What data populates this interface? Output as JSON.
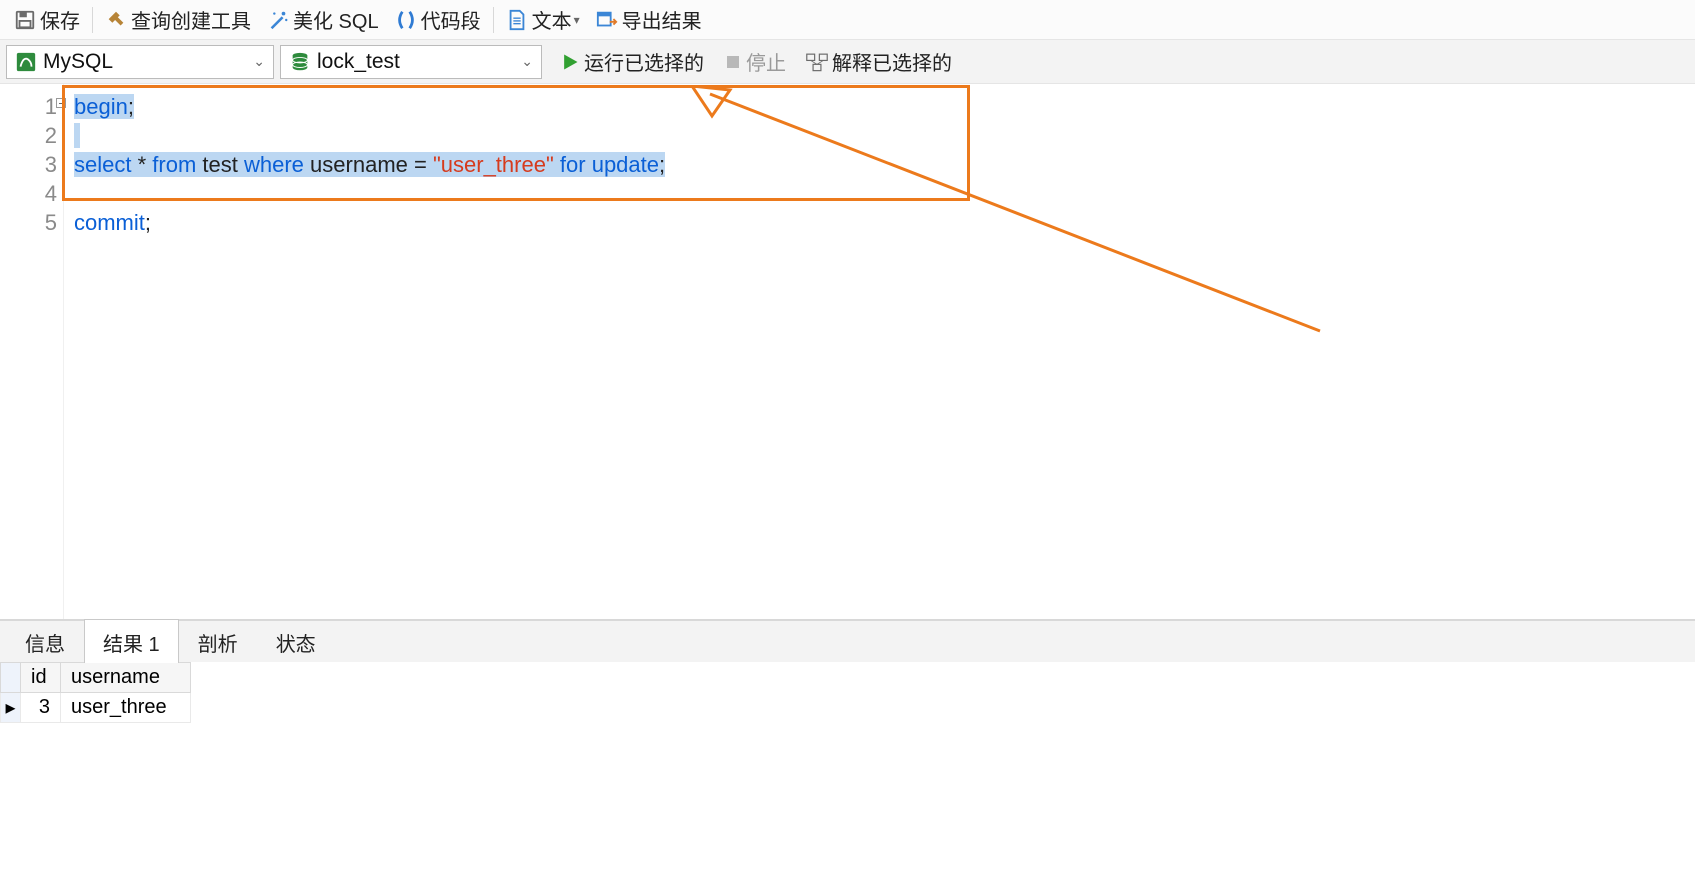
{
  "toolbar1": {
    "save": "保存",
    "query_builder": "查询创建工具",
    "beautify_sql": "美化 SQL",
    "code_snippet": "代码段",
    "text": "文本",
    "export_result": "导出结果"
  },
  "toolbar2": {
    "connection": "MySQL",
    "database": "lock_test",
    "run_selected": "运行已选择的",
    "stop": "停止",
    "explain_selected": "解释已选择的"
  },
  "editor": {
    "lines": [
      "1",
      "2",
      "3",
      "4",
      "5"
    ],
    "tokens": {
      "l1_begin": "begin",
      "l1_semi": ";",
      "l3_select": "select",
      "l3_star": " * ",
      "l3_from": "from",
      "l3_sp1": " ",
      "l3_test": "test",
      "l3_sp2": " ",
      "l3_where": "where",
      "l3_sp3": " ",
      "l3_username": "username",
      "l3_eq": " = ",
      "l3_str": "\"user_three\"",
      "l3_sp4": " ",
      "l3_for": "for",
      "l3_sp5": " ",
      "l3_update": "update",
      "l3_semi": ";",
      "l5_commit": "commit",
      "l5_semi": ";"
    }
  },
  "tabs": {
    "info": "信息",
    "result1": "结果 1",
    "profile": "剖析",
    "status": "状态"
  },
  "result": {
    "columns": {
      "id": "id",
      "username": "username"
    },
    "row_marker": "▸",
    "rows": [
      {
        "id": "3",
        "username": "user_three"
      }
    ]
  },
  "colors": {
    "annotation": "#ec7a1c",
    "keyword": "#0a5fd6",
    "string": "#d63b1e",
    "selection": "#bcd7f2"
  }
}
